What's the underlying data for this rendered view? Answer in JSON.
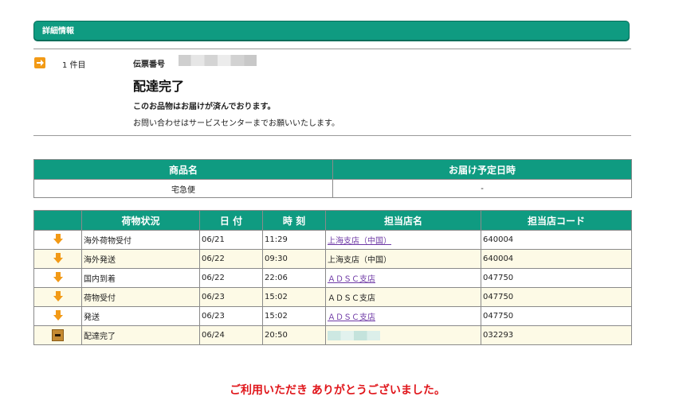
{
  "header": {
    "title": "詳細情報"
  },
  "item": {
    "count_label": "1 件目",
    "slip_label": "伝票番号",
    "status_title": "配達完了",
    "message_bold": "このお品物はお届けが済んでおります。",
    "message_info": "お問い合わせはサービスセンターまでお願いいたします。"
  },
  "product_table": {
    "headers": [
      "商品名",
      "お届け予定日時"
    ],
    "row": [
      "宅急便",
      "-"
    ]
  },
  "tracking_table": {
    "headers": [
      "",
      "荷物状況",
      "日 付",
      "時 刻",
      "担当店名",
      "担当店コード"
    ],
    "rows": [
      {
        "status": "海外荷物受付",
        "date": "06/21",
        "time": "11:29",
        "store": "上海支店（中国）",
        "store_link": true,
        "code": "640004",
        "icon": "down-arrow-icon"
      },
      {
        "status": "海外発送",
        "date": "06/22",
        "time": "09:30",
        "store": "上海支店（中国）",
        "store_link": false,
        "code": "640004",
        "icon": "down-arrow-icon"
      },
      {
        "status": "国内到着",
        "date": "06/22",
        "time": "22:06",
        "store": "ＡＤＳＣ支店",
        "store_link": true,
        "code": "047750",
        "icon": "down-arrow-icon"
      },
      {
        "status": "荷物受付",
        "date": "06/23",
        "time": "15:02",
        "store": "ＡＤＳＣ支店",
        "store_link": false,
        "code": "047750",
        "icon": "down-arrow-icon"
      },
      {
        "status": "発送",
        "date": "06/23",
        "time": "15:02",
        "store": "ＡＤＳＣ支店",
        "store_link": true,
        "code": "047750",
        "icon": "down-arrow-icon"
      },
      {
        "status": "配達完了",
        "date": "06/24",
        "time": "20:50",
        "store": "",
        "store_link": false,
        "code": "032293",
        "icon": "package-box-icon"
      }
    ]
  },
  "footer": {
    "thanks": "ご利用いただき ありがとうございました。"
  },
  "colors": {
    "header_green": "#0f9b81",
    "link_purple": "#6f3aa6",
    "thanks_red": "#e0161b",
    "arrow_orange": "#f29a16"
  }
}
